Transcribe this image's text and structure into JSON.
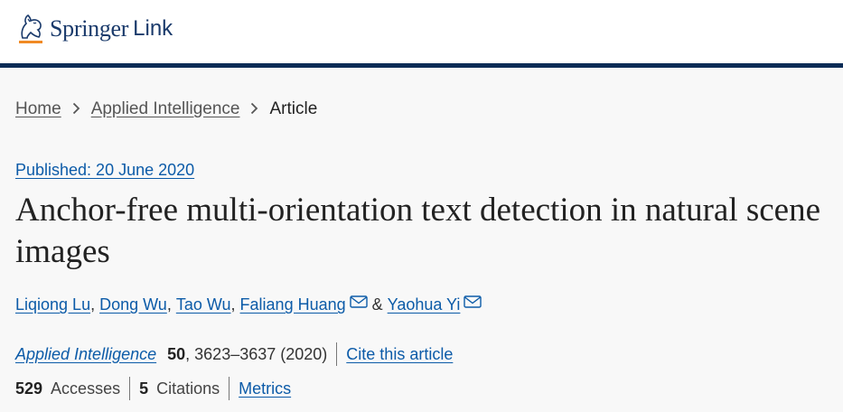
{
  "header": {
    "logo_main": "Springer",
    "logo_sub": "Link",
    "colors": {
      "navy": "#0c2c56",
      "accent": "#f08a24"
    }
  },
  "breadcrumb": {
    "home": "Home",
    "journal": "Applied Intelligence",
    "current": "Article",
    "separator_icon": "chevron-right-icon"
  },
  "article": {
    "published": "Published: 20 June 2020",
    "title": "Anchor-free multi-orientation text detection in natural scene images",
    "authors": [
      {
        "name": "Liqiong Lu",
        "sep": ", "
      },
      {
        "name": "Dong Wu",
        "sep": ", "
      },
      {
        "name": "Tao Wu",
        "sep": ", "
      },
      {
        "name": "Faliang Huang",
        "sep": " & ",
        "email_icon": "mail-icon"
      },
      {
        "name": "Yaohua Yi",
        "email_icon": "mail-icon"
      }
    ],
    "journal": "Applied Intelligence",
    "volume": "50",
    "pages_year": ", 3623–3637 (2020)",
    "cite_label": "Cite this article",
    "accesses_count": "529",
    "accesses_label": "Accesses",
    "citations_count": "5",
    "citations_label": "Citations",
    "metrics_label": "Metrics"
  }
}
